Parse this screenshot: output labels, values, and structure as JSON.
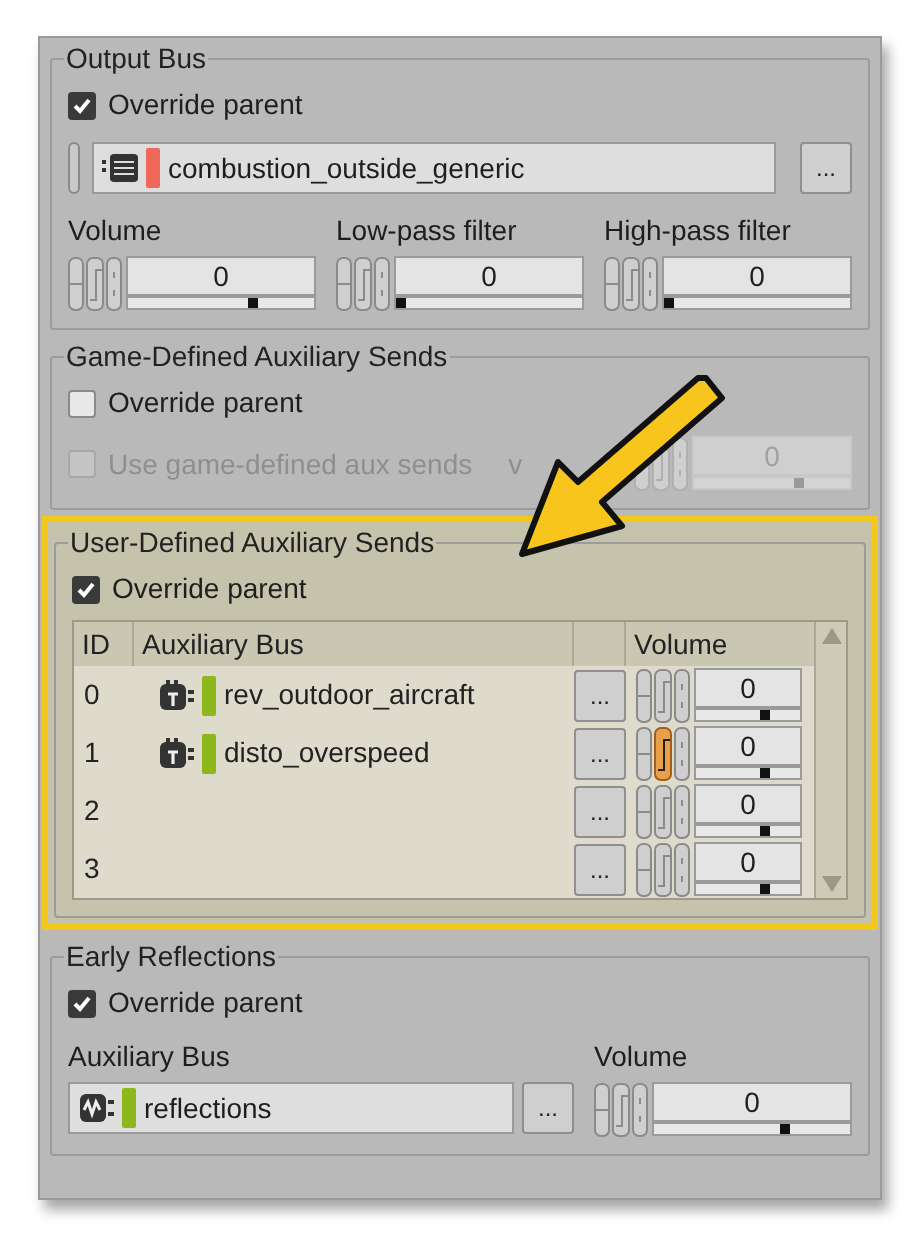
{
  "output_bus": {
    "title": "Output Bus",
    "override": {
      "label": "Override parent",
      "checked": true
    },
    "bus": {
      "name": "combustion_outside_generic",
      "color": "#f0675c"
    },
    "browse": "...",
    "controls": [
      {
        "label": "Volume",
        "value": "0",
        "level": 0.68
      },
      {
        "label": "Low-pass filter",
        "value": "0",
        "level": 0
      },
      {
        "label": "High-pass filter",
        "value": "0",
        "level": 0
      }
    ]
  },
  "game_defined": {
    "title": "Game-Defined Auxiliary Sends",
    "override": {
      "label": "Override parent",
      "checked": false
    },
    "use_game": {
      "label": "Use game-defined aux sends",
      "checked": false,
      "disabled": true
    },
    "volume_label": "v",
    "volume": {
      "value": "0",
      "level": 0.68,
      "disabled": true
    }
  },
  "user_defined": {
    "title": "User-Defined Auxiliary Sends",
    "highlighted": true,
    "override": {
      "label": "Override parent",
      "checked": true
    },
    "columns": [
      "ID",
      "Auxiliary Bus",
      "Volume"
    ],
    "rows": [
      {
        "id": "0",
        "bus": "rev_outdoor_aircraft",
        "color": "#8cb81c",
        "browse": "...",
        "value": "0",
        "level": 0.68,
        "active": false
      },
      {
        "id": "1",
        "bus": "disto_overspeed",
        "color": "#8cb81c",
        "browse": "...",
        "value": "0",
        "level": 0.68,
        "active": true
      },
      {
        "id": "2",
        "browse": "...",
        "value": "0",
        "level": 0.68,
        "active": false
      },
      {
        "id": "3",
        "browse": "...",
        "value": "0",
        "level": 0.68,
        "active": false
      }
    ]
  },
  "early_reflections": {
    "title": "Early Reflections",
    "override": {
      "label": "Override parent",
      "checked": true
    },
    "bus_label": "Auxiliary Bus",
    "bus": {
      "name": "reflections",
      "color": "#8cb81c"
    },
    "browse": "...",
    "volume_label": "Volume",
    "volume": {
      "value": "0",
      "level": 0.68
    }
  }
}
